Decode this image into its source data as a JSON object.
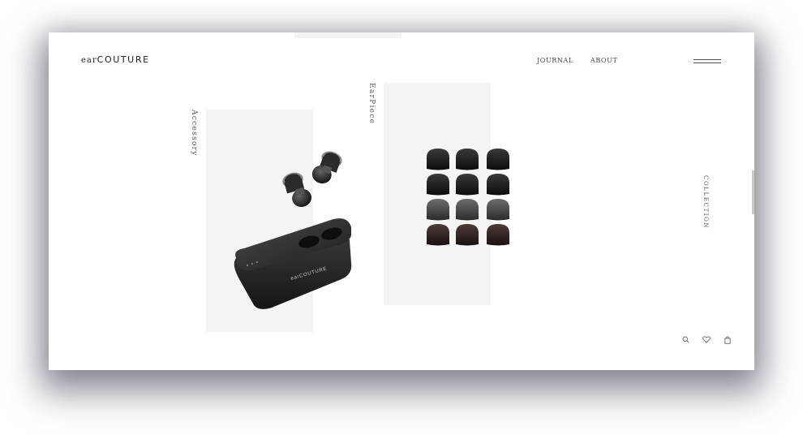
{
  "brand": {
    "logo_prefix": "ear",
    "logo_main": "COUTURE"
  },
  "nav": {
    "journal": "JOURNAL",
    "about": "ABOUT"
  },
  "sections": {
    "accessory_label": "Accessory",
    "earpiece_label": "EarPiece",
    "collection_label": "COLLECTION"
  },
  "product": {
    "case_engraving": "earCOUTURE"
  },
  "icons": {
    "menu": "hamburger-icon",
    "search": "search-icon",
    "favorite": "heart-icon",
    "cart": "bag-icon"
  },
  "colors": {
    "panel": "#f4f4f4",
    "text": "#444444",
    "product_dark": "#2b2b2b"
  }
}
